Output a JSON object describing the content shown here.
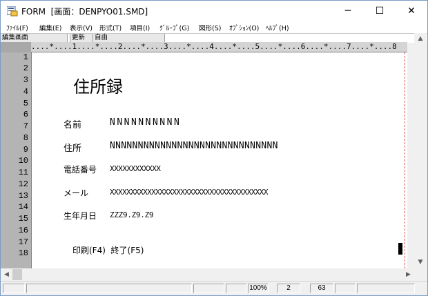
{
  "window": {
    "title": "FORM  [画面：DENPYO01.SMD]",
    "controls": {
      "minimize": "─",
      "maximize": "☐",
      "close": "✕"
    }
  },
  "menu": [
    "ﾌｧｲﾙ(F)",
    "編集(E)",
    "表示(V)",
    "形式(T)",
    "項目(I)",
    "ｸﾞﾙｰﾌﾟ(G)",
    "図形(S)",
    "ｵﾌﾟｼｮﾝ(O)",
    "ﾍﾙﾌﾟ(H)"
  ],
  "mode_bar": {
    "mode": "編集画面",
    "update": "更新",
    "layout": "自由"
  },
  "ruler": "....*....1....*....2....*....3....*....4....*....5....*....6....*....7....*....8",
  "line_numbers": [
    "1",
    "2",
    "3",
    "4",
    "5",
    "6",
    "7",
    "8",
    "9",
    "10",
    "11",
    "12",
    "13",
    "14",
    "15",
    "16",
    "17",
    "18"
  ],
  "form": {
    "heading": "住所録",
    "fields": [
      {
        "label": "名前",
        "value": "NNNNNNNNNN"
      },
      {
        "label": "住所",
        "value": "NNNNNNNNNNNNNNNNNNNNNNNNNNNNNN"
      },
      {
        "label": "電話番号",
        "value": "XXXXXXXXXXXX"
      },
      {
        "label": "メール",
        "value": "XXXXXXXXXXXXXXXXXXXXXXXXXXXXXXXXXXXXXX"
      },
      {
        "label": "生年月日",
        "value": "ZZZ9.Z9.Z9"
      }
    ],
    "function_keys": "印刷(F4)  終了(F5)"
  },
  "scroll": {
    "up": "▲",
    "down": "▼",
    "left": "◀",
    "right": "▶"
  },
  "status": {
    "zoom": "100%",
    "col_a": "2",
    "col_b": "63"
  }
}
